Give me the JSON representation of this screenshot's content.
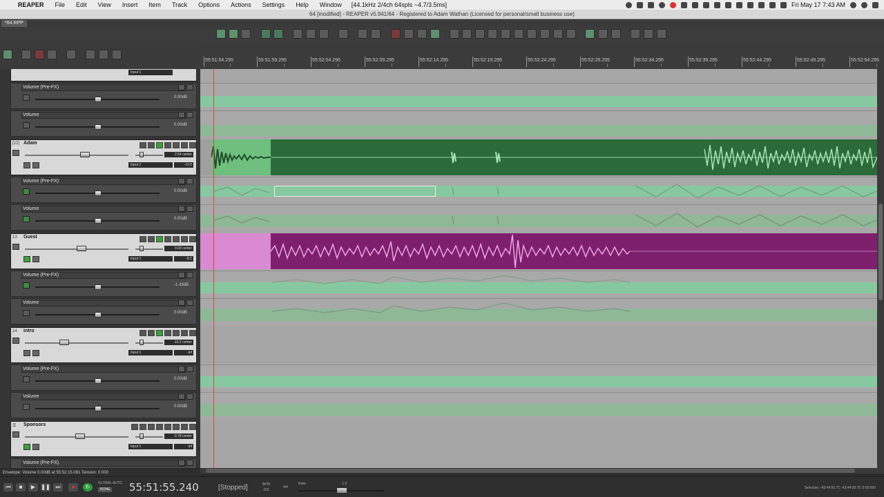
{
  "menubar": {
    "app": "REAPER",
    "items": [
      "File",
      "Edit",
      "View",
      "Insert",
      "Item",
      "Track",
      "Options",
      "Actions",
      "Settings",
      "Help",
      "Window"
    ],
    "extra": "[44.1kHz 2/4ch 64spls ~4.7/3.5ms]",
    "clock": "Fri May 17  7:43 AM"
  },
  "window": {
    "title": "64 [modified] - REAPER v5.941/64 - Registered to Adam Wathan (Licensed for personal/small business use)"
  },
  "project_tab": "*64.RPP",
  "ruler": {
    "labels": [
      "55:51:54.295",
      "55:51:59.295",
      "55:52:04.295",
      "55:52:09.295",
      "55:52:14.295",
      "55:52:19.295",
      "55:52:24.295",
      "55:52:29.295",
      "55:52:34.295",
      "55:52:39.295",
      "55:52:44.295",
      "55:52:49.295",
      "55:52:54.295"
    ]
  },
  "tcp": {
    "top_partial": {
      "input": "Input 1"
    },
    "rows": [
      {
        "kind": "env",
        "name": "Volume (Pre-FX)",
        "value": "0.00dB",
        "armed": false
      },
      {
        "kind": "env",
        "name": "Volume",
        "value": "0.00dB",
        "armed": false
      },
      {
        "kind": "track",
        "num": "[12]",
        "name": "Adam",
        "vol": "2.54  center",
        "input": "Input 1",
        "peak": "-10.5"
      },
      {
        "kind": "env",
        "name": "Volume (Pre-FX)",
        "value": "0.00dB",
        "armed": true
      },
      {
        "kind": "env",
        "name": "Volume",
        "value": "0.00dB",
        "armed": true
      },
      {
        "kind": "track",
        "num": "13",
        "name": "Guest",
        "vol": "0.00  center",
        "input": "Input 1",
        "peak": "-8.1"
      },
      {
        "kind": "env",
        "name": "Volume (Pre-FX)",
        "value": "-1.43dB",
        "armed": true
      },
      {
        "kind": "env",
        "name": "Volume",
        "value": "0.00dB",
        "armed": false
      },
      {
        "kind": "track",
        "num": "14",
        "name": "intro",
        "vol": "-10.2  center",
        "input": "Input 1",
        "peak": "-inf"
      },
      {
        "kind": "env",
        "name": "Volume (Pre-FX)",
        "value": "0.00dB",
        "armed": false
      },
      {
        "kind": "env",
        "name": "Volume",
        "value": "0.00dB",
        "armed": false
      },
      {
        "kind": "track",
        "num": "",
        "name": "Sponsors",
        "vol": "-0.78  center",
        "input": "Input 1",
        "peak": "-inf"
      },
      {
        "kind": "env",
        "name": "Volume (Pre-FX)",
        "value": "",
        "armed": false
      }
    ]
  },
  "status_line": "Envelope: Volume 0.00dB at 55:52:15.081 Tension: 0.000",
  "transport": {
    "global_auto": "GLOBAL AUTO",
    "global_auto_value": "NONE",
    "timecode": "55:51:55.240",
    "state": "[Stopped]",
    "bpm_label": "BPM",
    "bpm": "200",
    "time_sig": "4/4",
    "rate_label": "Rate:",
    "rate": "1.0",
    "selection": "Selection: -43:44:50.7C -43:44:50.7C 0:00:000"
  },
  "colors": {
    "adam_item": "#2b6b3a",
    "guest_item": "#7e1f6d",
    "envelope_band": "#86c9a0",
    "arrange_bg": "#a7a7a7",
    "edit_cursor": "#dd4444"
  }
}
